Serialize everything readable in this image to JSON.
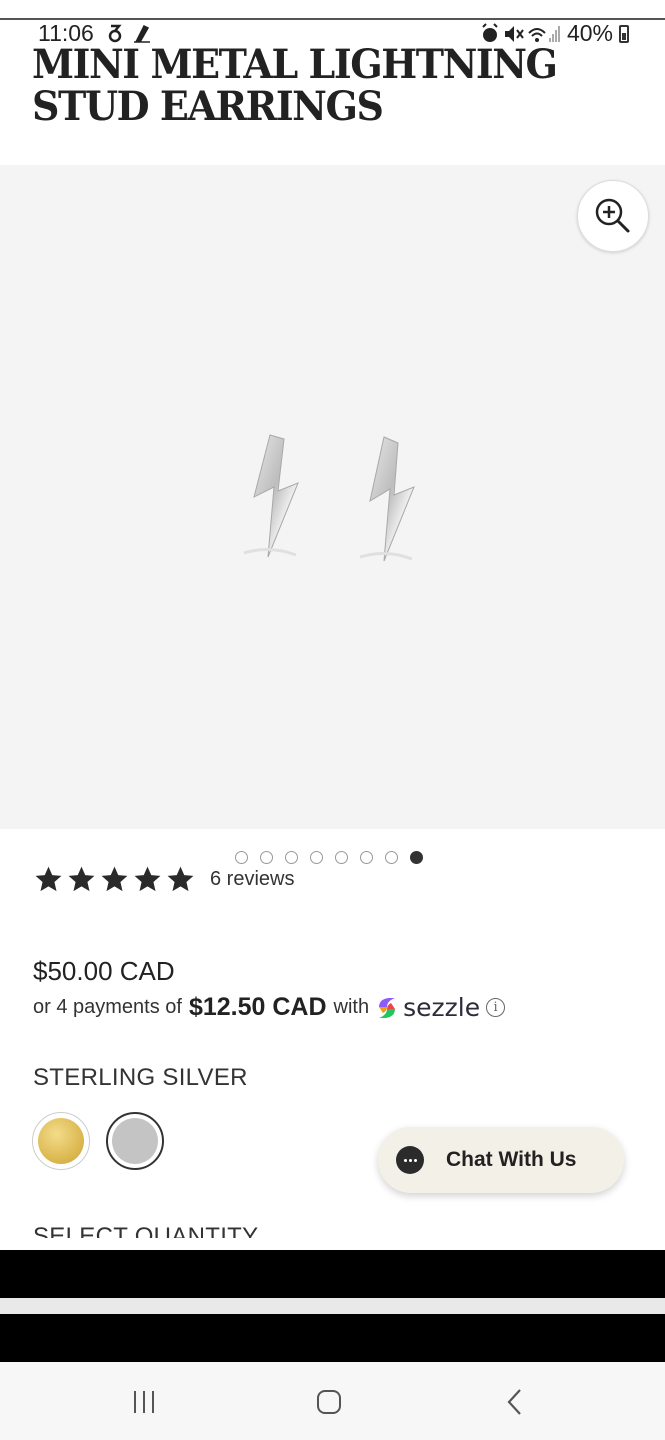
{
  "status_bar": {
    "time": "11:06",
    "battery": "40%",
    "left_icons": [
      "notification-icon",
      "edit-icon"
    ],
    "right_icons": [
      "alarm-icon",
      "mute-icon",
      "wifi-icon",
      "signal-icon",
      "battery-icon"
    ]
  },
  "product": {
    "title": "MINI METAL LIGHTNING STUD EARRINGS",
    "rating_stars": 5,
    "reviews": "6 reviews",
    "price": "$50.00 CAD",
    "installment_prefix": "or 4 payments of",
    "installment_amount": "$12.50 CAD",
    "installment_suffix": "with",
    "payment_provider": "sezzle",
    "variant_label": "STERLING SILVER",
    "next_section_label": "SELECT QUANTITY"
  },
  "gallery": {
    "image_count": 8,
    "active_index": 7,
    "zoom_icon": "zoom-in-icon"
  },
  "swatches": [
    {
      "name": "gold",
      "color": "#d9b44a",
      "selected": false
    },
    {
      "name": "sterling-silver",
      "color": "#c4c4c4",
      "selected": true
    }
  ],
  "chat": {
    "label": "Chat With Us"
  },
  "colors": {
    "gallery_bg": "#f4f4f4",
    "chat_bg": "#f3f0e8",
    "text": "#222222"
  }
}
